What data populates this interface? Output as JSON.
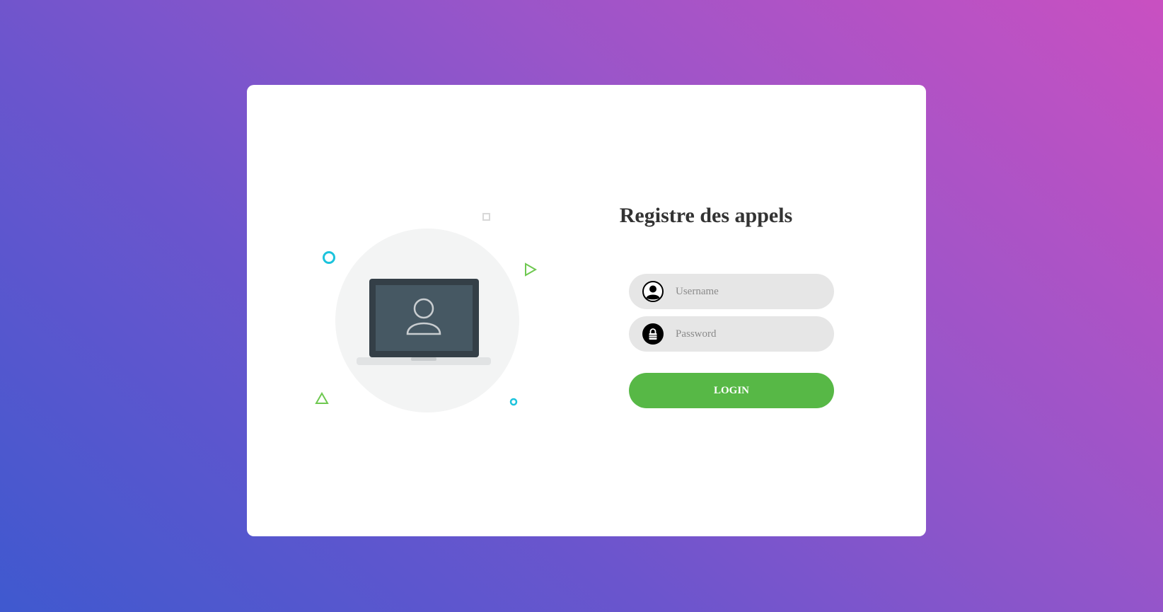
{
  "login": {
    "title": "Registre des appels",
    "username": {
      "placeholder": "Username",
      "value": "",
      "icon": "user-circle-icon"
    },
    "password": {
      "placeholder": "Password",
      "value": "",
      "icon": "lock-icon"
    },
    "submit_label": "LOGIN"
  },
  "illustration": {
    "image": "laptop-with-user-icon",
    "decorations": [
      "circle-outline-icon",
      "square-outline-icon",
      "triangle-right-icon",
      "triangle-up-icon",
      "small-circle-icon"
    ]
  },
  "colors": {
    "background_gradient": [
      "#3f59cf",
      "#6b55cd",
      "#9a55c9",
      "#c950c1"
    ],
    "card": "#ffffff",
    "input_bg": "#e6e6e6",
    "button": "#57b846",
    "title": "#333333",
    "accent_cyan": "#1cc3dc",
    "accent_green": "#6ec850"
  }
}
